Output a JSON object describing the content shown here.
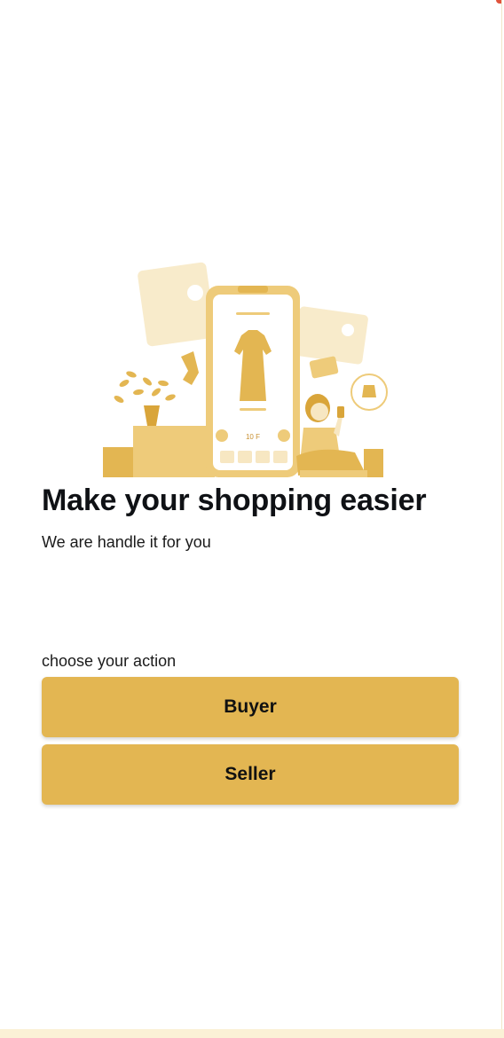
{
  "onboarding": {
    "title": "Make your shopping easier",
    "subtitle": "We are handle it for you",
    "choose_label": "choose your action",
    "buttons": {
      "buyer_label": "Buyer",
      "seller_label": "Seller"
    },
    "illustration": {
      "phone_price_text": "10 F",
      "icon": "shopping-illustration"
    }
  },
  "colors": {
    "accent": "#E3B652",
    "illustration_light": "#F7E7C2",
    "illustration_mid": "#EECB7A",
    "illustration_dark": "#D9A53A",
    "background": "#FFFFFF",
    "bottom_strip": "#FBF1D6"
  }
}
